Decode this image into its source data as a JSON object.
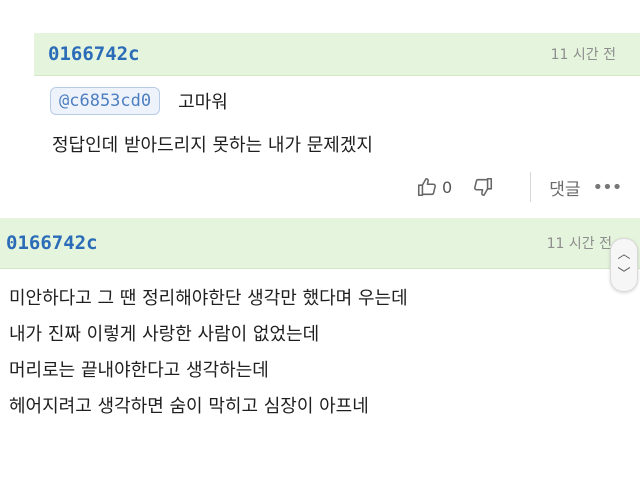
{
  "comments": [
    {
      "author": "0166742c",
      "time": "11 시간 전",
      "mention": "@c6853cd0",
      "mention_text": "고마워",
      "body": "정답인데 받아드리지 못하는 내가 문제겠지",
      "likes": "0",
      "reply_label": "댓글",
      "more": "•••"
    },
    {
      "author": "0166742c",
      "time": "11 시간 전",
      "lines": [
        "미안하다고 그 땐 정리해야한단 생각만 했다며 우는데",
        "내가 진짜 이렇게 사랑한 사람이 없었는데",
        "머리로는 끝내야한다고 생각하는데",
        "헤어지려고 생각하면 숨이 막히고 심장이 아프네"
      ]
    }
  ],
  "scroll": {
    "up": "︿",
    "down": "﹀"
  }
}
